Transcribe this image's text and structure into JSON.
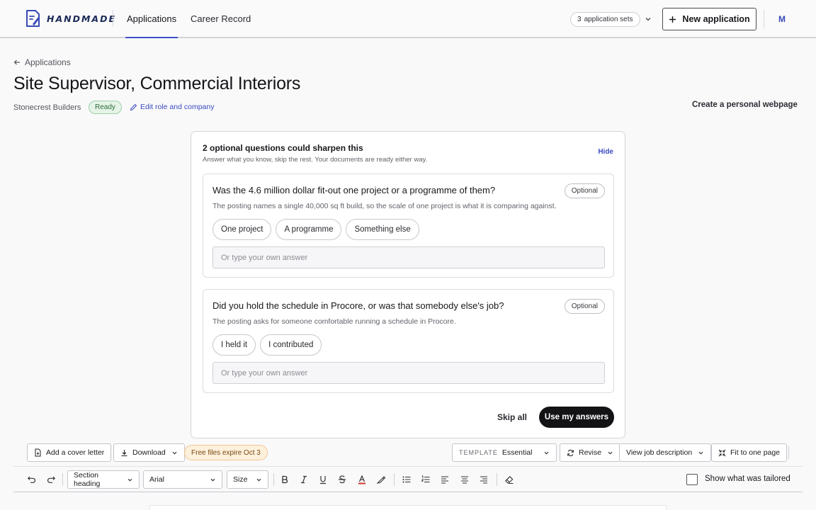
{
  "app": {
    "brand": "HANDMADE",
    "nav": [
      {
        "label": "Applications"
      },
      {
        "label": "Career Record"
      }
    ],
    "sets_count": "3",
    "sets_label": "application sets",
    "new_application_label": "New application",
    "avatar_initial": "M"
  },
  "page": {
    "breadcrumb": "Applications",
    "title": "Site Supervisor, Commercial Interiors",
    "company": "Stonecrest Builders",
    "status": "Ready",
    "edit_link": "Edit role and company",
    "personal_webpage": "Create a personal webpage"
  },
  "questions_panel": {
    "title": "2 optional questions could sharpen this",
    "subtitle": "Answer what you know, skip the rest. Your documents are ready either way.",
    "hide_label": "Hide",
    "questions": [
      {
        "text": "Was the 4.6 million dollar fit-out one project or a programme of them?",
        "badge": "Optional",
        "note": "The posting names a single 40,000 sq ft build, so the scale of one project is what it is comparing against.",
        "options": [
          "One project",
          "A programme",
          "Something else"
        ],
        "placeholder": "Or type your own answer"
      },
      {
        "text": "Did you hold the schedule in Procore, or was that somebody else's job?",
        "badge": "Optional",
        "note": "The posting asks for someone comfortable running a schedule in Procore.",
        "options": [
          "I held it",
          "I contributed"
        ],
        "placeholder": "Or type your own answer"
      }
    ],
    "skip_all_label": "Skip all",
    "use_answers_label": "Use my answers"
  },
  "toolbar": {
    "add_cover_letter": "Add a cover letter",
    "download": "Download",
    "free_files": "Free files expire Oct 3",
    "template_label": "TEMPLATE",
    "template_value": "Essential",
    "revise": "Revise",
    "view_job_description": "View job description",
    "fit_to_one_page": "Fit to one page"
  },
  "format_bar": {
    "block_style": "Section heading",
    "font": "Arial",
    "size": "Size",
    "show_tailored_label": "Show what was tailored"
  },
  "colors": {
    "accent": "#3d52c8",
    "primary_button": "#131316",
    "ready_badge_bg": "#e6f4e8",
    "free_badge_bg": "#fdf0dc",
    "text_color_underline": "#d23a2e"
  }
}
